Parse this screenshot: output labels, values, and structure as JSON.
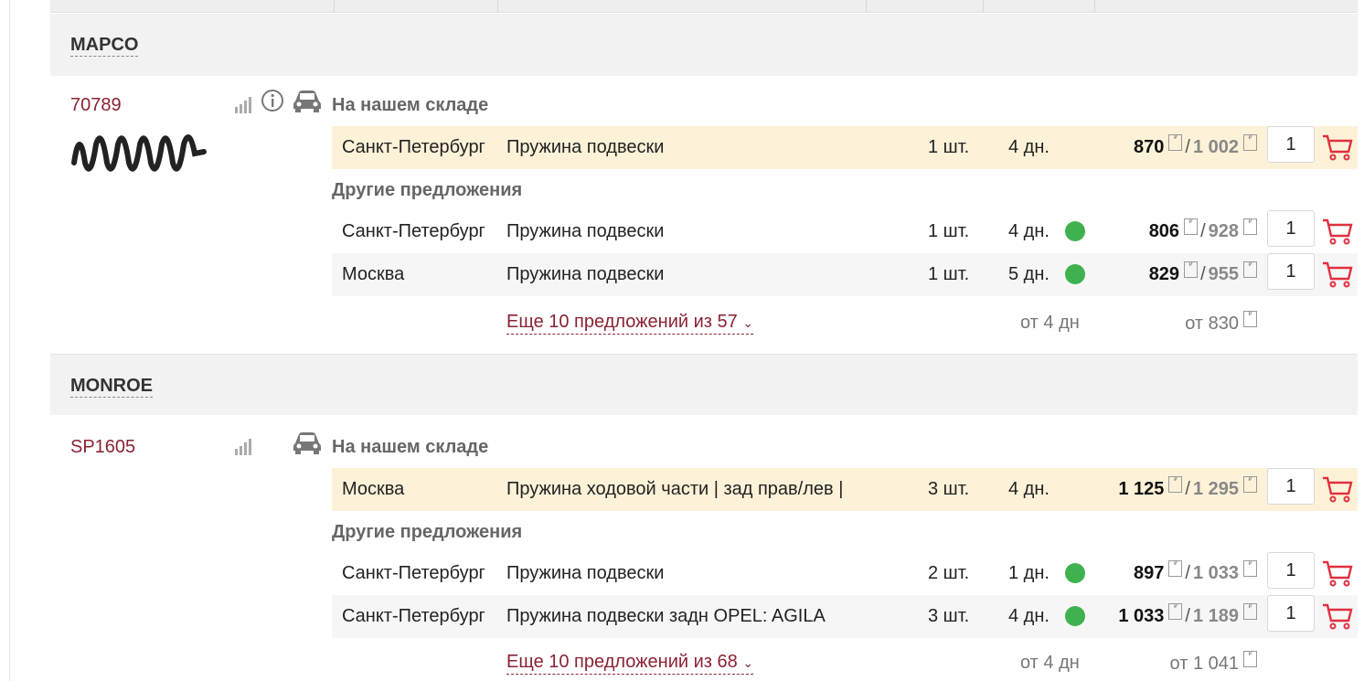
{
  "brands": [
    {
      "name": "MAPCO",
      "article": "70789",
      "stock_label": "На нашем складе",
      "own_offer": {
        "city": "Санкт-Петербург",
        "description": "Пружина подвески",
        "qty": "1 шт.",
        "days": "4 дн.",
        "price": "870",
        "price_old": "1 002",
        "input_qty": "1"
      },
      "others_label": "Другие предложения",
      "offers": [
        {
          "city": "Санкт-Петербург",
          "description": "Пружина подвески",
          "qty": "1 шт.",
          "days": "4 дн.",
          "price": "806",
          "price_old": "928",
          "input_qty": "1"
        },
        {
          "city": "Москва",
          "description": "Пружина подвески",
          "qty": "1 шт.",
          "days": "5 дн.",
          "price": "829",
          "price_old": "955",
          "input_qty": "1"
        }
      ],
      "more_link": "Еще 10 предложений из 57",
      "more_days": "от 4 дн",
      "more_price": "от 830"
    },
    {
      "name": "MONROE",
      "article": "SP1605",
      "stock_label": "На нашем складе",
      "own_offer": {
        "city": "Москва",
        "description": "Пружина ходовой части | зад прав/лев |",
        "qty": "3 шт.",
        "days": "4 дн.",
        "price": "1 125",
        "price_old": "1 295",
        "input_qty": "1"
      },
      "others_label": "Другие предложения",
      "offers": [
        {
          "city": "Санкт-Петербург",
          "description": "Пружина подвески",
          "qty": "2 шт.",
          "days": "1 дн.",
          "price": "897",
          "price_old": "1 033",
          "input_qty": "1"
        },
        {
          "city": "Санкт-Петербург",
          "description": "Пружина подвески задн OPEL: AGILA",
          "qty": "3 шт.",
          "days": "4 дн.",
          "price": "1 033",
          "price_old": "1 189",
          "input_qty": "1"
        }
      ],
      "more_link": "Еще 10 предложений из 68",
      "more_days": "от 4 дн",
      "more_price": "от 1 041"
    }
  ],
  "icons": {
    "signal": "signal-bars-icon",
    "info": "info-icon",
    "car": "car-icon",
    "cart": "cart-icon",
    "chevron": "chevron-down-icon",
    "rub": "currency-icon",
    "status": "availability-dot-icon"
  },
  "colors": {
    "accent": "#8a2233",
    "cart": "#e0303f",
    "highlight": "#fdf2d8",
    "status_green": "#3fb24f"
  }
}
